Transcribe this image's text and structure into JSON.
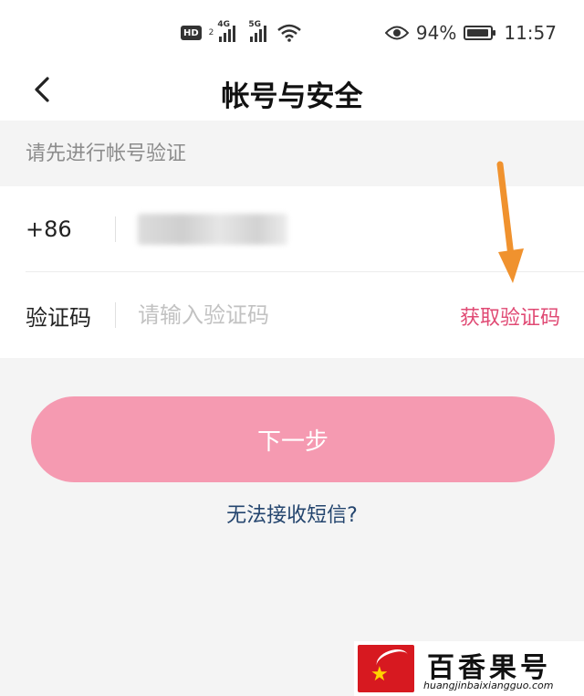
{
  "status_bar": {
    "hd_badge": "HD",
    "hd_sub": "2",
    "network_1": "4G",
    "network_2": "5G",
    "battery_percent": "94%",
    "battery_level": 0.94,
    "time": "11:57"
  },
  "nav": {
    "title": "帐号与安全"
  },
  "form": {
    "hint": "请先进行帐号验证",
    "phone_prefix": "+86",
    "code_label": "验证码",
    "code_placeholder": "请输入验证码",
    "get_code_label": "获取验证码"
  },
  "actions": {
    "next_label": "下一步",
    "sms_help": "无法接收短信?"
  },
  "watermark": {
    "name": "百香果号",
    "url": "huangjinbaixiangguo.com"
  },
  "colors": {
    "accent": "#e04a74",
    "button_bg": "#f59ab1",
    "link": "#24456e",
    "annotation_arrow": "#f0922e"
  }
}
